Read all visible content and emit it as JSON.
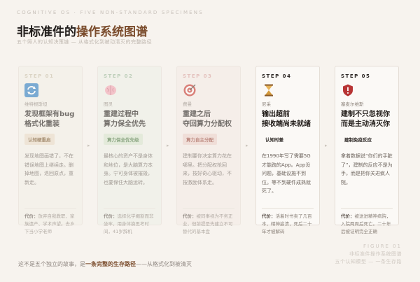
{
  "header": {
    "eyebrow": "COGNITIVE OS · FIVE NON-STANDARD SPECIMENS",
    "title_prefix": "非标准件的",
    "title_accent": "操作系统图谱",
    "subtitle": "五个照人的认知决策链 — 从格式化到被动清灭的完整路径"
  },
  "cards": [
    {
      "step": "STEP 01",
      "icon": "refresh-icon",
      "tagline": "维特根斯坦",
      "title_line1": "发现框架有bug",
      "title_line2": "格式化重装",
      "badge": "认知硬重启",
      "body": "发现地图画错了，不在错误地图上继续走。删掉地图，退回原点，重新走。",
      "cost_label": "代价：",
      "cost_text": "放弃自我教职、家族遗产、学术声望。去乡下当小学老师",
      "accent": "#5a88b0",
      "badge_bg": "#eadcc8",
      "badge_fg": "#7a5a30"
    },
    {
      "step": "STEP 02",
      "icon": "brain-icon",
      "tagline": "图灵",
      "title_line1": "重建过程中",
      "title_line2": "算力保全优先",
      "badge": "算力保全优先级",
      "body": "最核心的资产不是身体和地位，是大脑算力本身。宁可身体被摧毁，也要保住大脑运转。",
      "cost_label": "代价：",
      "cost_text": "选择化学阉割而非坐牢，用身体换思考时间，41岁辞机",
      "accent": "#7aa07a",
      "badge_bg": "#d8e6cf",
      "badge_fg": "#4d7a44"
    },
    {
      "step": "STEP 03",
      "icon": "target-icon",
      "tagline": "费曼",
      "title_line1": "重建之后",
      "title_line2": "夺回算力分配权",
      "badge": "算力自主分配",
      "body": "建制要你决定算力花在哪里。把分配权抢回来，按好奇心驱动，不按激励体系走。",
      "cost_label": "代价：",
      "cost_text": "被同事视为不务正业，但前提是先建立不可替代的基本盘",
      "accent": "#c0504a",
      "badge_bg": "#ecd2cc",
      "badge_fg": "#9a4a3e"
    },
    {
      "step": "STEP 04",
      "icon": "hourglass-icon",
      "tagline": "尼采",
      "title_line1": "输出超前",
      "title_line2": "接收端尚未就绪",
      "badge": "认知时差",
      "body": "在1990年写了需要5G才能跑的App。App没问题，基础设施不到位。等不到硬件成熟就死了。",
      "cost_label": "代价：",
      "cost_text": "活着时书卖了几百本，精神崩溃，死后二十年才被解码",
      "accent": "#c88a30",
      "badge_bg": "transparent",
      "badge_fg": "#2b2623"
    },
    {
      "step": "STEP 05",
      "icon": "shield-icon",
      "tagline": "塞麦尔维斯",
      "title_line1": "建制不只忽视你",
      "title_line2": "而是主动消灭你",
      "badge": "建制免疫反应",
      "body": "拿着数据说“你们的手脏了”，建制的反应不是为手，而是把你关进疯人院。",
      "cost_label": "代价：",
      "cost_text": "被送进精神病院，入院两周后死亡。二十年后被证明完全正确",
      "accent": "#b03838",
      "badge_bg": "transparent",
      "badge_fg": "#2b2623"
    }
  ],
  "arrow_glyph": "▸",
  "footer": {
    "pre": "这不是五个独立的故事，是",
    "highlight": "一条完整的生存路径",
    "post": "——从格式化到被清灭"
  },
  "figure": {
    "label": "FIGURE 01",
    "line1": "非标准件操作系统图谱",
    "line2": "五个认知模型 — 一条生存路"
  }
}
